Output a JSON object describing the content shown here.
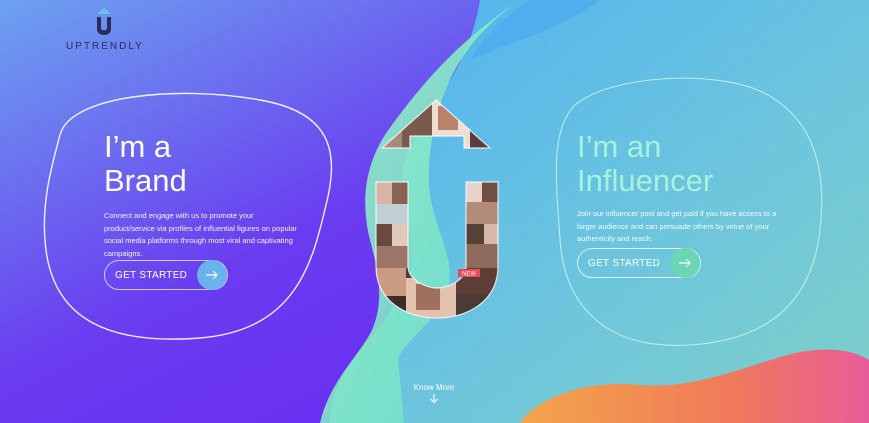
{
  "brand": {
    "logo_text": "UPTRENDLY",
    "logo_icon": "u-arrow-logo-icon"
  },
  "left_panel": {
    "headline_line1": "I’m a",
    "headline_line2": "Brand",
    "description": "Connect and engage with us to promote your product/service via profiles of influential figures on popular social media platforms through most viral and captivating campaigns.",
    "cta_label": "GET STARTED",
    "cta_icon": "arrow-right-icon"
  },
  "right_panel": {
    "headline_line1": "I’m an",
    "headline_line2": "Influencer",
    "description": "Join our influencer pool and get paid if you have access to a larger audience and can persuade others by virtue of your authenticity and reach.",
    "cta_label": "GET STARTED",
    "cta_icon": "arrow-right-icon"
  },
  "footer": {
    "know_more_label": "Know More",
    "know_more_icon": "arrow-down-icon"
  },
  "graphic": {
    "name": "u-arrow-photo-collage",
    "tile_labels": [
      "NEW"
    ]
  },
  "colors": {
    "left_purple": "#7b2ff0",
    "left_blue": "#5a7de6",
    "right_sky": "#55b8ee",
    "right_teal": "#78cfd4",
    "accent_mint": "#8ff0c8",
    "accent_orange": "#f39a4a",
    "accent_pink": "#ea5f98"
  }
}
